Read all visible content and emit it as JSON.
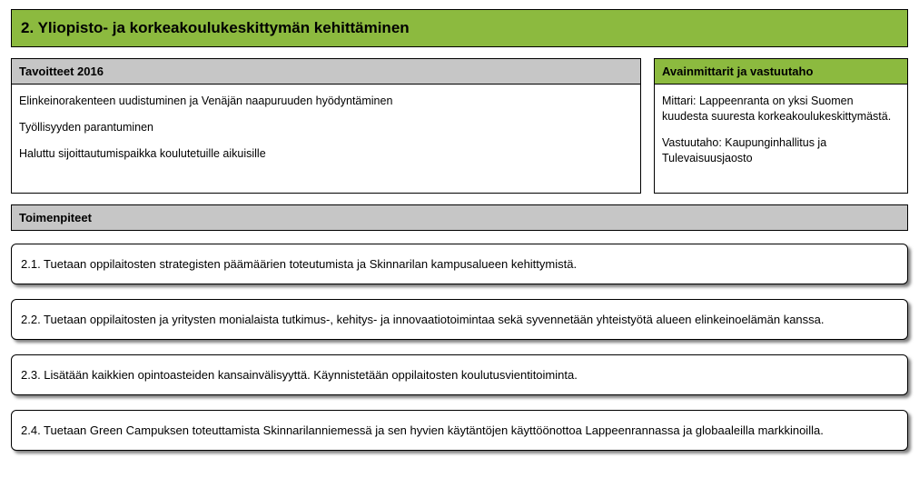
{
  "title": "2. Yliopisto- ja korkeakoulukeskittymän kehittäminen",
  "tavoitteet": {
    "header": "Tavoitteet 2016",
    "items": [
      "Elinkeinorakenteen uudistuminen ja Venäjän naapuruuden hyödyntäminen",
      "Työllisyyden parantuminen",
      "Haluttu sijoittautumispaikka koulutetuille aikuisille"
    ]
  },
  "mittarit": {
    "header": "Avainmittarit ja vastuutaho",
    "items": [
      "Mittari: Lappeenranta on yksi Suomen kuudesta suuresta korkeakoulukeskittymästä.",
      "Vastuutaho: Kaupunginhallitus ja Tulevaisuusjaosto"
    ]
  },
  "toimenpiteet": {
    "header": "Toimenpiteet",
    "items": [
      "2.1. Tuetaan oppilaitosten strategisten päämäärien toteutumista ja Skinnarilan kampusalueen kehittymistä.",
      "2.2. Tuetaan oppilaitosten ja yritysten monialaista tutkimus-, kehitys- ja innovaatiotoimintaa sekä syvennetään yhteistyötä alueen elinkeinoelämän kanssa.",
      "2.3. Lisätään kaikkien opintoasteiden kansainvälisyyttä. Käynnistetään oppilaitosten koulutusvientitoiminta.",
      "2.4. Tuetaan Green Campuksen  toteuttamista  Skinnarilanniemessä ja sen hyvien käytäntöjen käyttöönottoa Lappeenrannassa ja globaaleilla markkinoilla."
    ]
  }
}
